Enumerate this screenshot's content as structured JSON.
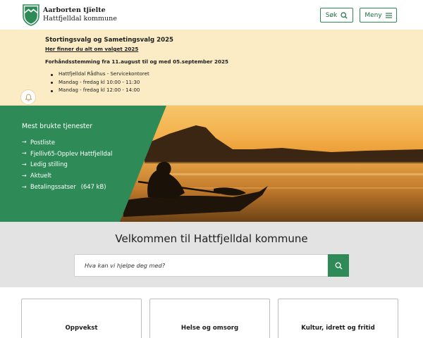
{
  "header": {
    "logo_line1": "Aarborten tjïelte",
    "logo_line2": "Hattfjelldal kommune",
    "search_label": "Søk",
    "menu_label": "Meny"
  },
  "alert": {
    "title": "Stortingsvalg og Sametingsvalg 2025",
    "link": "Her finner du alt om valget 2025",
    "subtitle": "Forhåndsstemming fra 11.august til og med 05.september 2025",
    "items": [
      "Hattfjelldal Rådhus - Servicekontoret",
      "Mandag - fredag kl 10:00 - 11:30",
      "Mandag - fredag kl 12:00 - 14:00"
    ]
  },
  "services": {
    "title": "Mest brukte tjenester",
    "items": [
      {
        "label": "Postliste",
        "extra": ""
      },
      {
        "label": "Fjelliv65-Opplev Hattfjelldal",
        "extra": ""
      },
      {
        "label": "Ledig stilling",
        "extra": ""
      },
      {
        "label": "Aktuelt",
        "extra": ""
      },
      {
        "label": "Betalingssatser",
        "extra": "(647 kB)"
      }
    ]
  },
  "welcome": {
    "title": "Velkommen til Hattfjelldal kommune",
    "search_placeholder": "Hva kan vi hjelpe deg med?"
  },
  "cards": [
    {
      "label": "Oppvekst"
    },
    {
      "label": "Helse og omsorg"
    },
    {
      "label": "Kultur, idrett og fritid"
    }
  ],
  "colors": {
    "brand_green": "#2e8b57",
    "alert_background": "#fbecc6",
    "welcome_background": "#e3e3e3"
  },
  "icons": {
    "logo": "municipal-shield-icon",
    "search": "search-icon",
    "menu": "hamburger-icon",
    "alert": "bell-icon",
    "link_arrow": "arrow-right-icon"
  }
}
